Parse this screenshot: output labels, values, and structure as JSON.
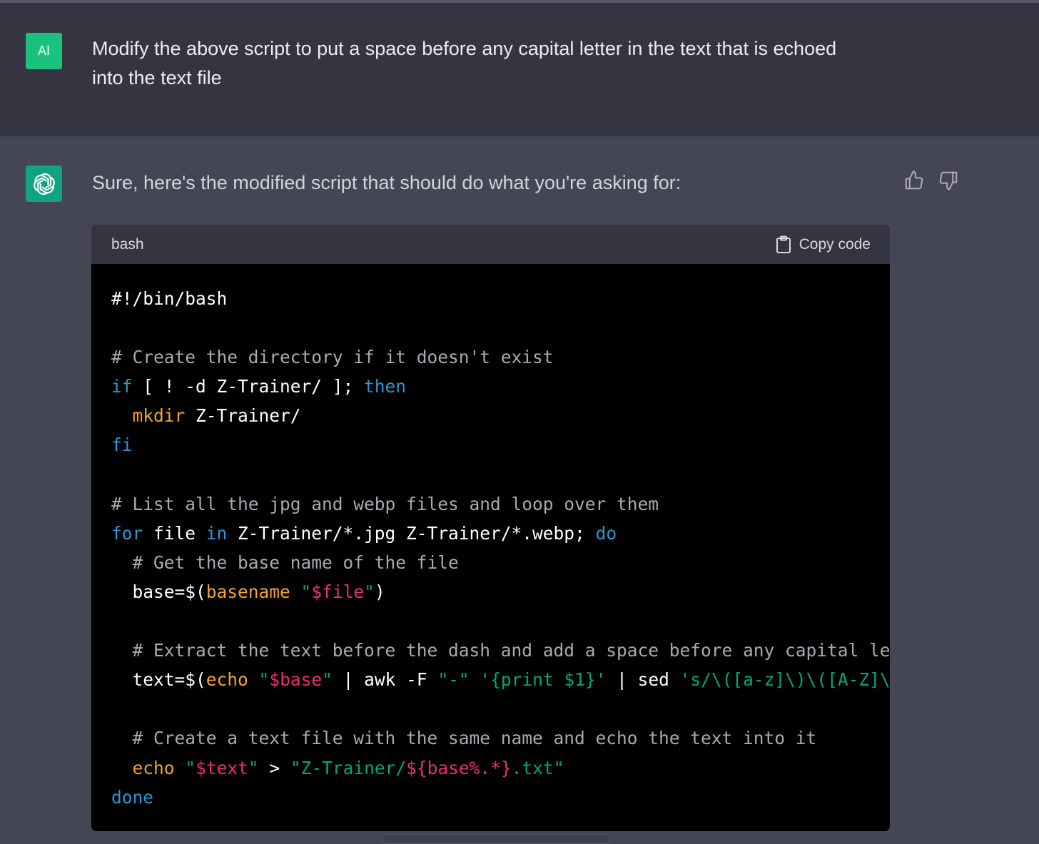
{
  "user_message": {
    "avatar_label": "AI",
    "text": "Modify the above script to put a space before any capital letter in the text that is echoed into the text file"
  },
  "assistant_message": {
    "avatar_icon": "openai-logo-icon",
    "text": "Sure, here's the modified script that should do what you're asking for:",
    "feedback": {
      "thumbs_up_icon": "thumbs-up-icon",
      "thumbs_down_icon": "thumbs-down-icon"
    }
  },
  "code_block": {
    "language": "bash",
    "copy_label": "Copy code",
    "lines": [
      [
        {
          "t": "#!/bin/bash",
          "k": "plain"
        }
      ],
      [],
      [
        {
          "t": "# Create the directory if it doesn't exist",
          "k": "comment"
        }
      ],
      [
        {
          "t": "if",
          "k": "keyword"
        },
        {
          "t": " [ ! -d Z-Trainer/ ]; ",
          "k": "plain"
        },
        {
          "t": "then",
          "k": "keyword"
        }
      ],
      [
        {
          "t": "  ",
          "k": "plain"
        },
        {
          "t": "mkdir",
          "k": "builtin"
        },
        {
          "t": " Z-Trainer/",
          "k": "plain"
        }
      ],
      [
        {
          "t": "fi",
          "k": "keyword"
        }
      ],
      [],
      [
        {
          "t": "# List all the jpg and webp files and loop over them",
          "k": "comment"
        }
      ],
      [
        {
          "t": "for",
          "k": "keyword"
        },
        {
          "t": " file ",
          "k": "plain"
        },
        {
          "t": "in",
          "k": "keyword"
        },
        {
          "t": " Z-Trainer/*.jpg Z-Trainer/*.webp; ",
          "k": "plain"
        },
        {
          "t": "do",
          "k": "keyword"
        }
      ],
      [
        {
          "t": "  # Get the base name of the file",
          "k": "comment"
        }
      ],
      [
        {
          "t": "  base=$(",
          "k": "plain"
        },
        {
          "t": "basename",
          "k": "builtin"
        },
        {
          "t": " ",
          "k": "plain"
        },
        {
          "t": "\"",
          "k": "string"
        },
        {
          "t": "$file",
          "k": "variable"
        },
        {
          "t": "\"",
          "k": "string"
        },
        {
          "t": ")",
          "k": "plain"
        }
      ],
      [],
      [
        {
          "t": "  # Extract the text before the dash and add a space before any capital lett",
          "k": "comment"
        }
      ],
      [
        {
          "t": "  text=$(",
          "k": "plain"
        },
        {
          "t": "echo",
          "k": "builtin"
        },
        {
          "t": " ",
          "k": "plain"
        },
        {
          "t": "\"",
          "k": "string"
        },
        {
          "t": "$base",
          "k": "variable"
        },
        {
          "t": "\"",
          "k": "string"
        },
        {
          "t": " | awk -F ",
          "k": "plain"
        },
        {
          "t": "\"-\"",
          "k": "string"
        },
        {
          "t": " ",
          "k": "plain"
        },
        {
          "t": "'{print $1}'",
          "k": "string"
        },
        {
          "t": " | sed ",
          "k": "plain"
        },
        {
          "t": "'s/\\([a-z]\\)\\([A-Z]\\)/",
          "k": "string"
        }
      ],
      [],
      [
        {
          "t": "  # Create a text file with the same name and echo the text into it",
          "k": "comment"
        }
      ],
      [
        {
          "t": "  ",
          "k": "plain"
        },
        {
          "t": "echo",
          "k": "builtin"
        },
        {
          "t": " ",
          "k": "plain"
        },
        {
          "t": "\"",
          "k": "string"
        },
        {
          "t": "$text",
          "k": "variable"
        },
        {
          "t": "\"",
          "k": "string"
        },
        {
          "t": " > ",
          "k": "plain"
        },
        {
          "t": "\"Z-Trainer/",
          "k": "string"
        },
        {
          "t": "${base%.*}",
          "k": "variable"
        },
        {
          "t": ".txt\"",
          "k": "string"
        }
      ],
      [
        {
          "t": "done",
          "k": "keyword"
        }
      ]
    ]
  },
  "colors": {
    "user_bg": "#343541",
    "assistant_bg": "#444654",
    "code_bg": "#000000",
    "comment": "#a9a9b3",
    "keyword": "#2e95d3",
    "builtin": "#f1a235",
    "string": "#00a67d",
    "variable": "#ec2d75",
    "avatar_user": "#19c37d",
    "avatar_bot": "#10a37f"
  }
}
